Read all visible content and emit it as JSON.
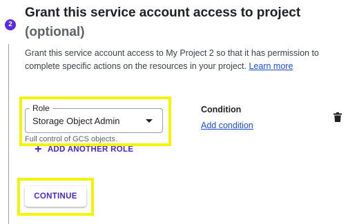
{
  "step": {
    "number": "2",
    "title": "Grant this service account access to project",
    "optional_label": "(optional)"
  },
  "description": {
    "text": "Grant this service account access to My Project 2 so that it has permission to complete specific actions on the resources in your project.",
    "learn_more": "Learn more"
  },
  "role": {
    "label": "Role",
    "value": "Storage Object Admin",
    "help_text": "Full control of GCS objects."
  },
  "condition": {
    "label": "Condition",
    "add_link": "Add condition"
  },
  "actions": {
    "add_role_label": "ADD ANOTHER ROLE",
    "continue_label": "CONTINUE"
  },
  "icons": {
    "delete": "trash-icon",
    "dropdown": "caret-down-icon",
    "add": "plus-icon"
  },
  "colors": {
    "accent": "#4b26c7",
    "badge": "#5b2be0",
    "link": "#1a4ed8",
    "highlight": "#f4f400"
  }
}
